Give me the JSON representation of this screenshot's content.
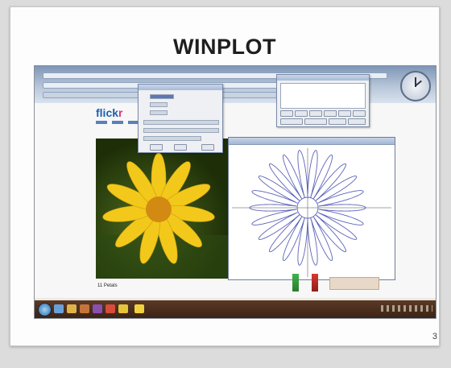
{
  "slide": {
    "title": "WINPLOT",
    "page_number": "3"
  },
  "screenshot": {
    "flickr_logo": {
      "part1": "flick",
      "part2": "r"
    },
    "photo_caption": "11 Petals",
    "graph": {
      "type": "polar rose",
      "petals": 22,
      "curve_color": "#5b63b8",
      "axis_color": "#888888"
    },
    "flower": {
      "petal_color": "#f2c81b",
      "center_color": "#d38a12"
    }
  },
  "colors": {
    "taskbar": "#3a2416",
    "browser_chrome": "#9fb2cc",
    "slide_background": "#fdfdfd"
  }
}
